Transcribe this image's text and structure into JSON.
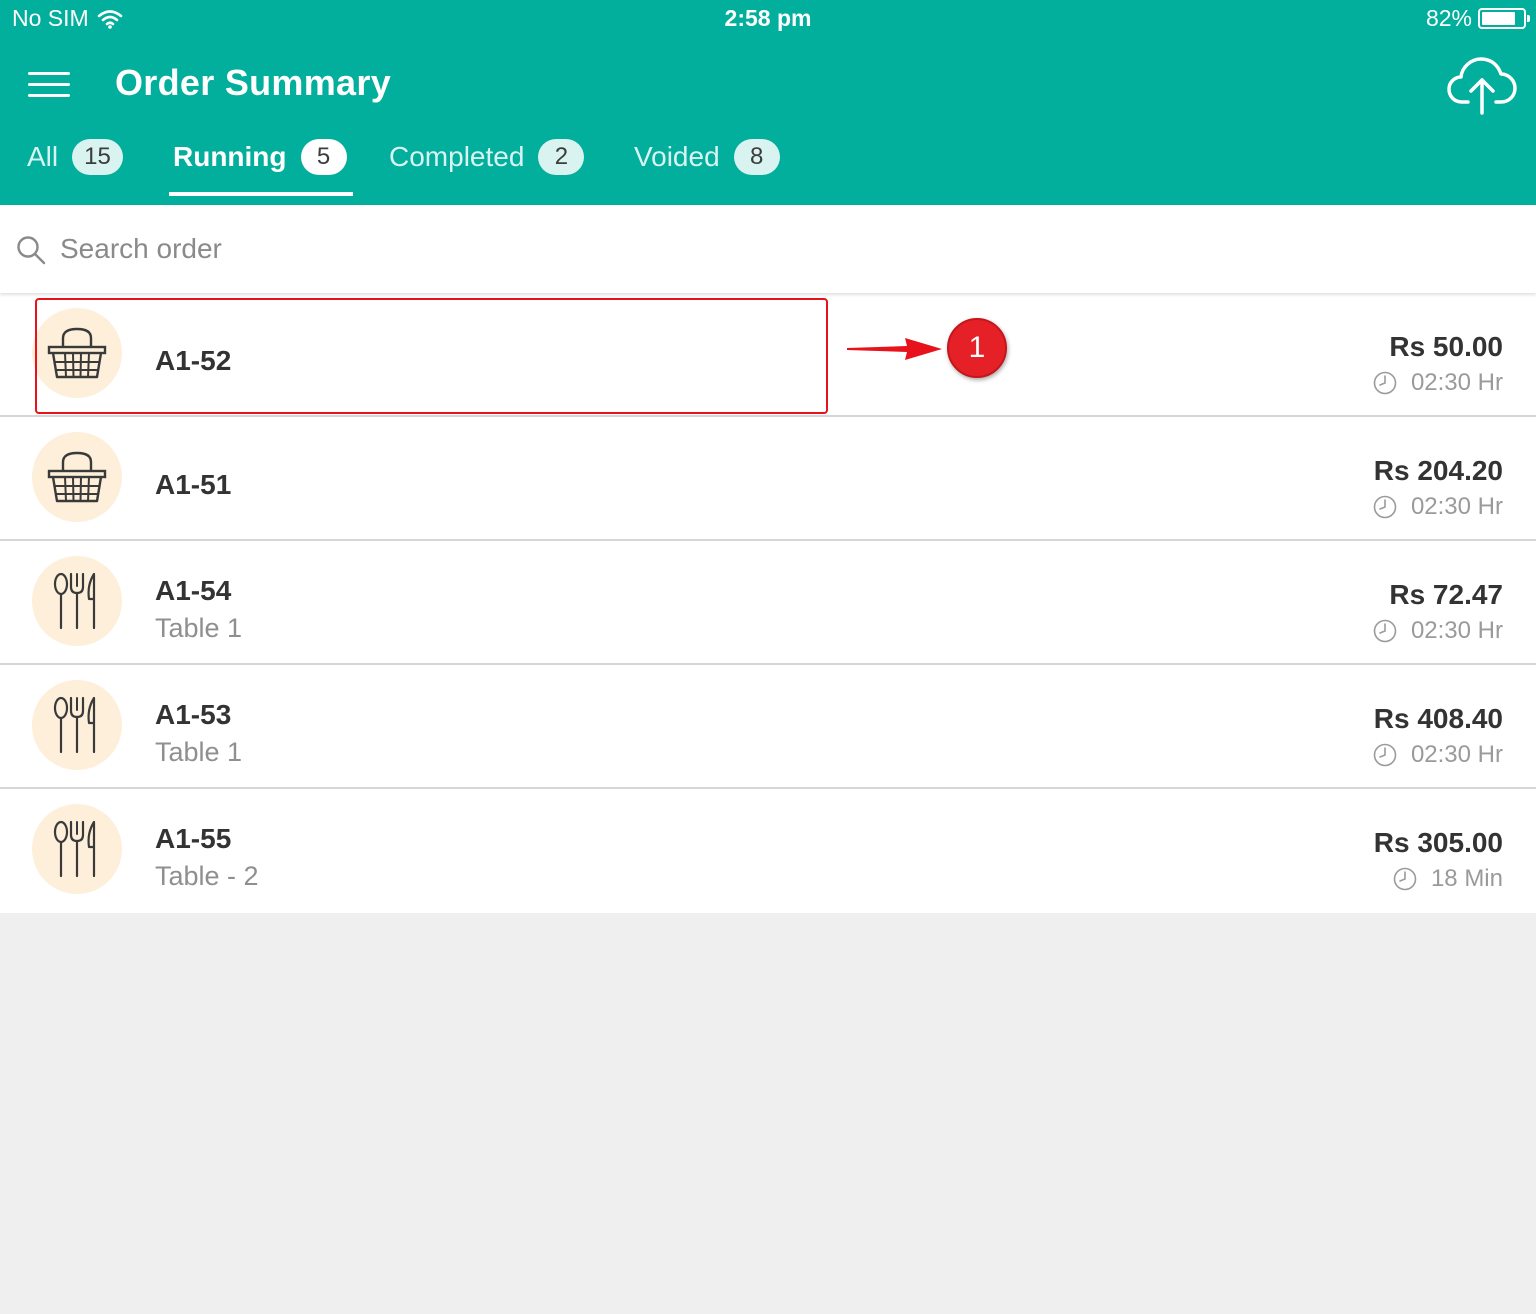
{
  "status_bar": {
    "carrier": "No SIM",
    "time": "2:58 pm",
    "battery": "82%",
    "battery_level": 0.82
  },
  "header": {
    "title": "Order Summary",
    "menu_icon": "hamburger-menu-icon",
    "upload_icon": "cloud-upload-icon"
  },
  "tabs": [
    {
      "label": "All",
      "count": "15",
      "active": false
    },
    {
      "label": "Running",
      "count": "5",
      "active": true
    },
    {
      "label": "Completed",
      "count": "2",
      "active": false
    },
    {
      "label": "Voided",
      "count": "8",
      "active": false
    }
  ],
  "search": {
    "placeholder": "Search order",
    "value": ""
  },
  "orders": [
    {
      "id": "A1-52",
      "table": "",
      "type": "takeaway",
      "icon": "basket-icon",
      "amount": "Rs 50.00",
      "time": "02:30 Hr"
    },
    {
      "id": "A1-51",
      "table": "",
      "type": "takeaway",
      "icon": "basket-icon",
      "amount": "Rs 204.20",
      "time": "02:30 Hr"
    },
    {
      "id": "A1-54",
      "table": "Table 1",
      "type": "dine-in",
      "icon": "cutlery-icon",
      "amount": "Rs 72.47",
      "time": "02:30 Hr"
    },
    {
      "id": "A1-53",
      "table": "Table 1",
      "type": "dine-in",
      "icon": "cutlery-icon",
      "amount": "Rs 408.40",
      "time": "02:30 Hr"
    },
    {
      "id": "A1-55",
      "table": "Table - 2",
      "type": "dine-in",
      "icon": "cutlery-icon",
      "amount": "Rs 305.00",
      "time": "18 Min"
    }
  ],
  "annotation": {
    "number": "1",
    "color": "#e52026"
  },
  "colors": {
    "primary": "#02ae9c",
    "avatar_bg": "#fdefd9",
    "background": "#efefef"
  }
}
